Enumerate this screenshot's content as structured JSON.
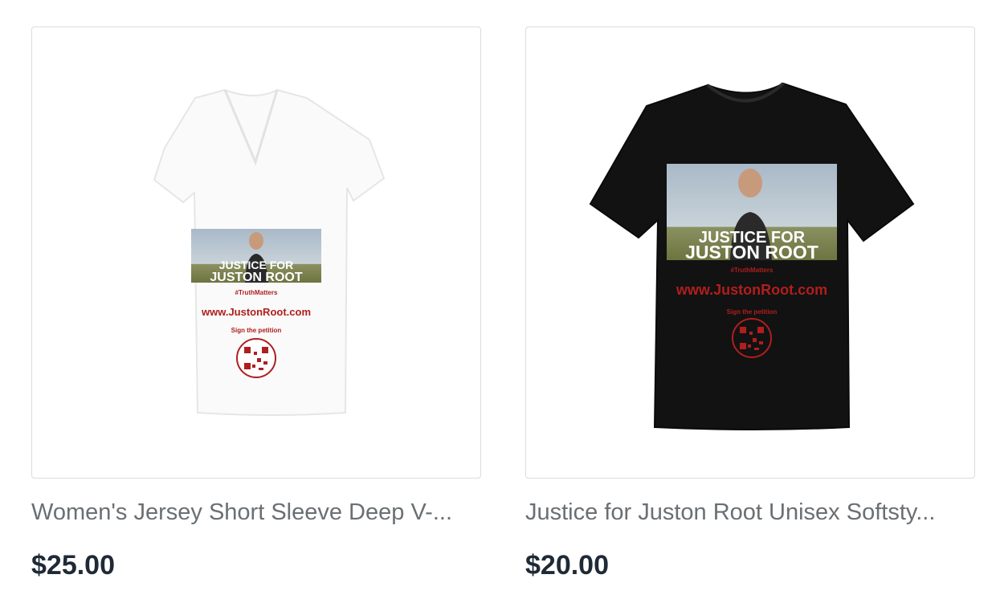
{
  "products": [
    {
      "title": "Women's Jersey Short Sleeve Deep V-...",
      "price": "$25.00",
      "shirt_color": "#fafafa",
      "image_text": {
        "line1": "JUSTICE FOR",
        "line2": "JUSTON ROOT",
        "hashtag": "#TruthMatters",
        "url": "www.JustonRoot.com",
        "cta": "Sign the petition"
      }
    },
    {
      "title": "Justice for Juston Root Unisex Softsty...",
      "price": "$20.00",
      "shirt_color": "#121212",
      "image_text": {
        "line1": "JUSTICE FOR",
        "line2": "JUSTON ROOT",
        "hashtag": "#TruthMatters",
        "url": "www.JustonRoot.com",
        "cta": "Sign the petition"
      }
    }
  ],
  "colors": {
    "title": "#6a6f73",
    "price": "#1f2a36",
    "card_border": "#dcdcdc",
    "print_red": "#b01e1e"
  }
}
